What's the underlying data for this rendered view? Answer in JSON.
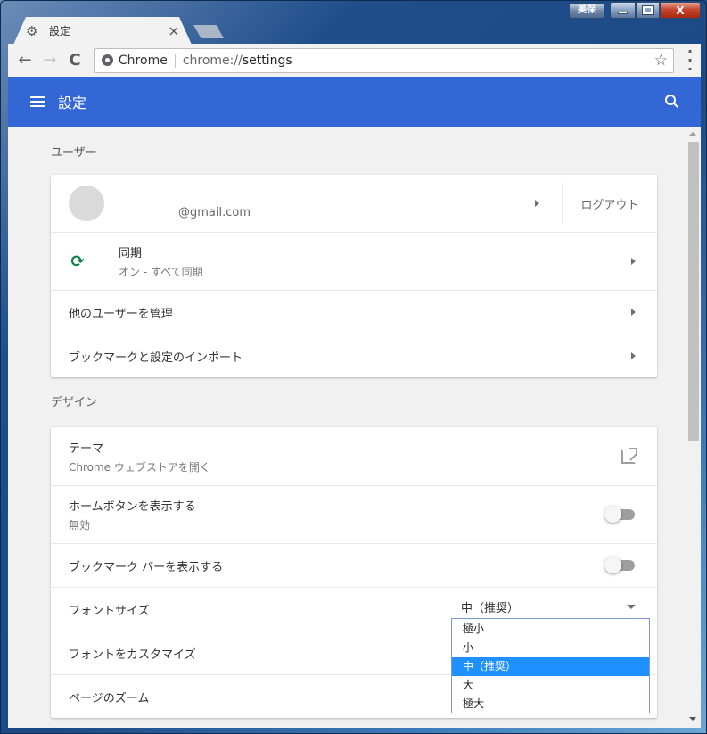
{
  "window": {
    "extension_label": "美保",
    "close_glyph": "X"
  },
  "tab": {
    "title": "設定",
    "icon": "gear-icon",
    "close_glyph": "×"
  },
  "toolbar": {
    "back_glyph": "←",
    "forward_glyph": "→",
    "reload_glyph": "C",
    "omnibox": {
      "chip": "Chrome",
      "url_scheme": "chrome://",
      "url_path": "settings"
    },
    "star_glyph": "☆",
    "menu_glyph": "⋮"
  },
  "header": {
    "title": "設定"
  },
  "sections": {
    "user": {
      "title": "ユーザー",
      "profile": {
        "email": "@gmail.com",
        "logout_label": "ログアウト"
      },
      "sync": {
        "label": "同期",
        "sub": "オン - すべて同期",
        "icon_glyph": "⟳"
      },
      "manage_users": "他のユーザーを管理",
      "import": "ブックマークと設定のインポート"
    },
    "design": {
      "title": "デザイン",
      "theme": {
        "label": "テーマ",
        "sub": "Chrome ウェブストアを開く"
      },
      "home_button": {
        "label": "ホームボタンを表示する",
        "sub": "無効",
        "enabled": false
      },
      "bookmark_bar": {
        "label": "ブックマーク バーを表示する",
        "enabled": false
      },
      "font_size": {
        "label": "フォントサイズ",
        "value": "中（推奨）",
        "options": [
          "極小",
          "小",
          "中（推奨）",
          "大",
          "極大"
        ],
        "selected_index": 2
      },
      "customize_fonts": "フォントをカスタマイズ",
      "page_zoom": "ページのズーム"
    }
  },
  "colors": {
    "header_blue": "#3367d6",
    "sync_green": "#0b8043",
    "selected_option": "#1e90ff"
  }
}
